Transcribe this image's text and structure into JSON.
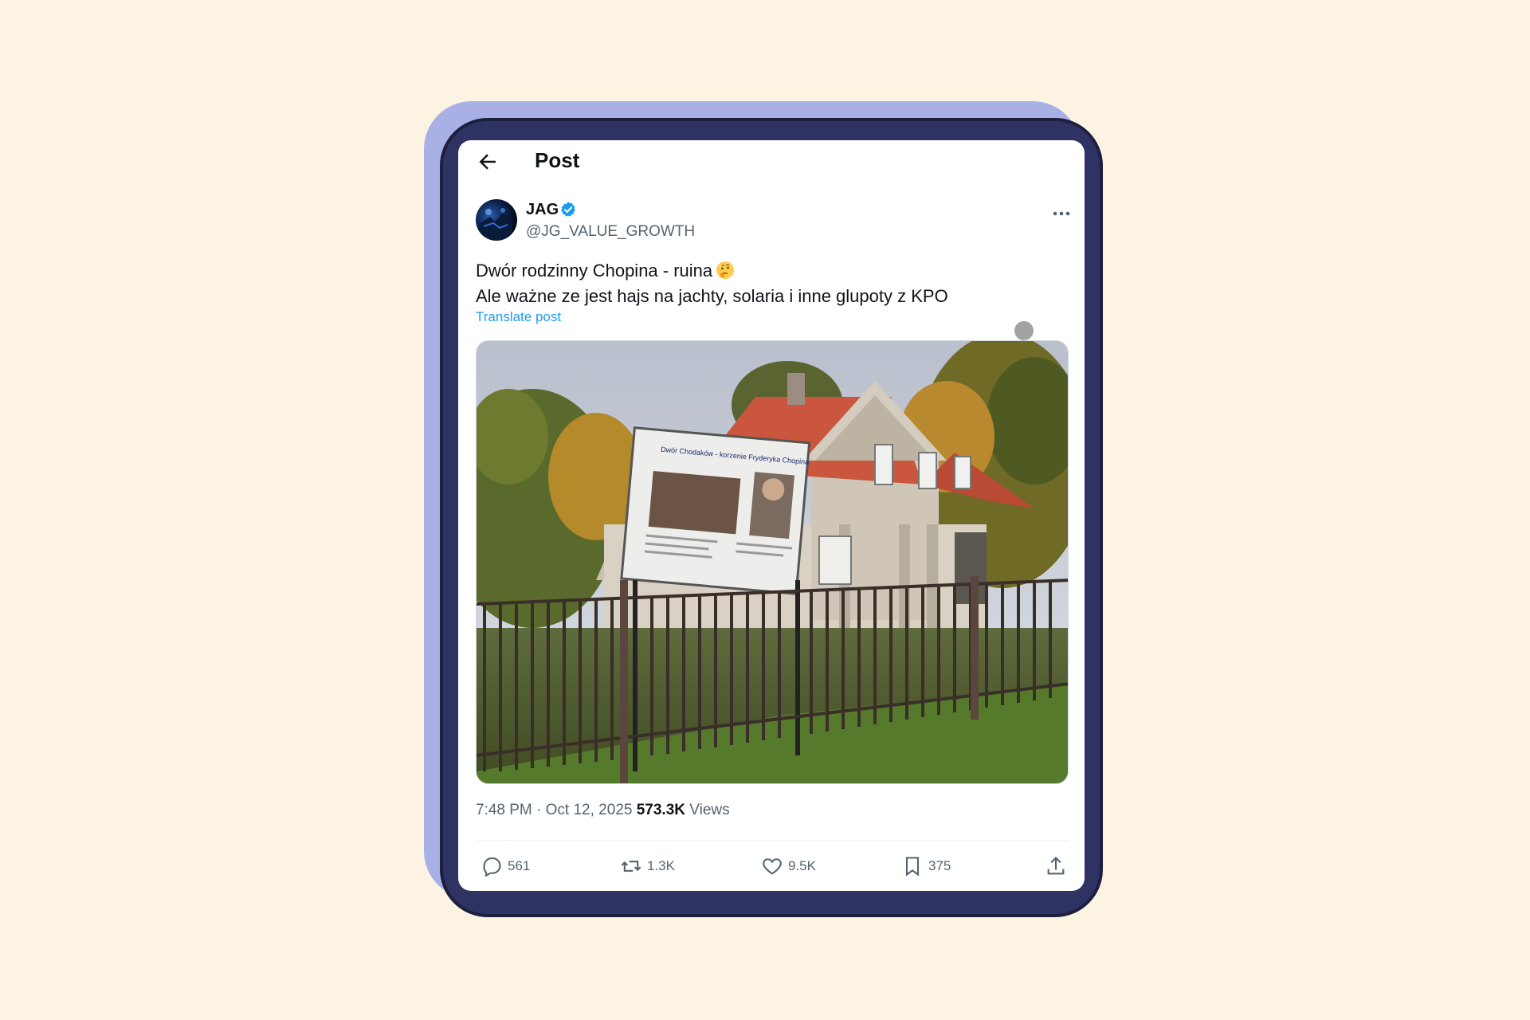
{
  "header": {
    "title": "Post"
  },
  "author": {
    "name": "JAG",
    "handle": "@JG_VALUE_GROWTH"
  },
  "post": {
    "line1": "Dwór rodzinny Chopina - ruina",
    "line2": "Ale ważne ze jest hajs na jachty, solaria i inne glupoty z KPO",
    "translate_label": "Translate post",
    "image_sign_title": "Dwór Chodaków - korzenie Fryderyka Chopina"
  },
  "meta": {
    "time": "7:48 PM",
    "separator": " · ",
    "date": "Oct 12, 2025",
    "views_count": "573.3K",
    "views_label": " Views"
  },
  "actions": {
    "replies": "561",
    "reposts": "1.3K",
    "likes": "9.5K",
    "bookmarks": "375"
  },
  "colors": {
    "background": "#fdf3e3",
    "frame": "#2e3363",
    "frame_shadow": "#a9b0e6",
    "link": "#1d9bf0",
    "verified": "#1d9bf0"
  }
}
